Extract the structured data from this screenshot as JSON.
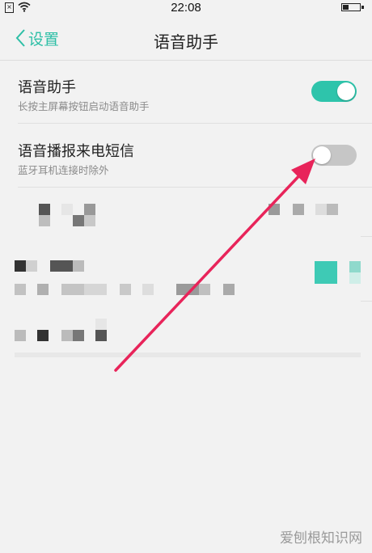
{
  "status_bar": {
    "time": "22:08",
    "sim_icon": "sim-card-icon",
    "wifi_icon": "wifi-icon",
    "battery_icon": "battery-icon"
  },
  "header": {
    "back_label": "设置",
    "title": "语音助手"
  },
  "settings": [
    {
      "title": "语音助手",
      "subtitle": "长按主屏幕按钮启动语音助手",
      "toggle_on": true
    },
    {
      "title": "语音播报来电短信",
      "subtitle": "蓝牙耳机连接时除外",
      "toggle_on": false
    }
  ],
  "colors": {
    "accent": "#2ec4ab",
    "arrow": "#e8245a",
    "toggle_off": "#c6c6c6"
  },
  "watermark": "爱刨根知识网"
}
